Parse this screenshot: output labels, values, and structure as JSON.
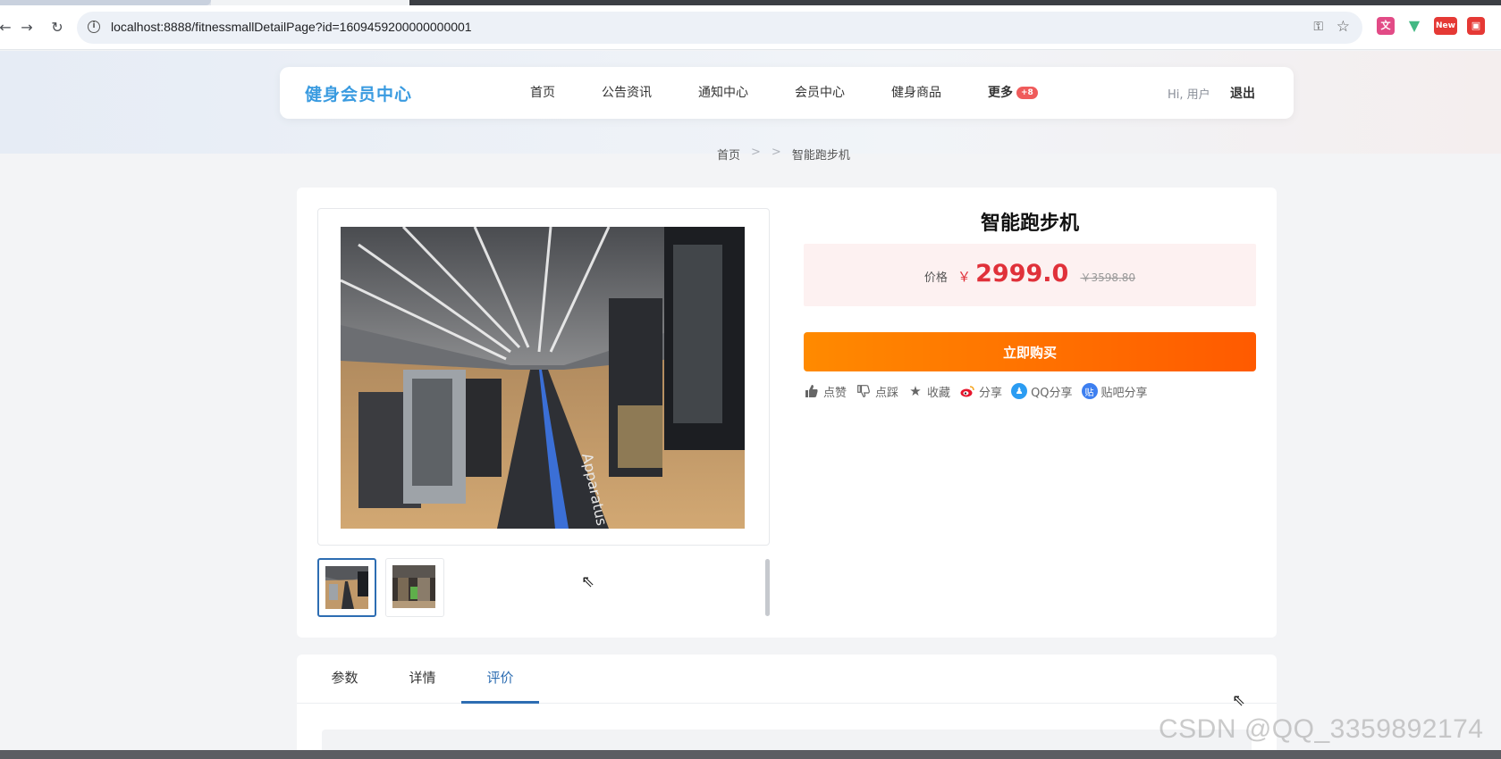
{
  "browser": {
    "url": "localhost:8888/fitnessmallDetailPage?id=1609459200000000001",
    "extensions": [
      "translate-ext",
      "vue-devtools-ext",
      "new-ext",
      "red-ext"
    ],
    "new_badge": "New"
  },
  "site": {
    "logo": "健身会员中心",
    "nav": [
      "首页",
      "公告资讯",
      "通知中心",
      "会员中心",
      "健身商品",
      "更多"
    ],
    "more_badge": "+8",
    "greeting": "Hi, 用户",
    "logout": "退出"
  },
  "breadcrumb": {
    "home": "首页",
    "sep1": ">",
    "sep2": ">",
    "current": "智能跑步机"
  },
  "product": {
    "title": "智能跑步机",
    "price_label": "价格",
    "currency": "￥",
    "price": "2999.0",
    "old_price": "￥3598.80",
    "buy_label": "立即购买",
    "actions": [
      "点赞",
      "点踩",
      "收藏",
      "分享",
      "QQ分享",
      "贴吧分享"
    ],
    "thumbnail_count": 2
  },
  "tabs": [
    "参数",
    "详情",
    "评价"
  ],
  "active_tab": "评价",
  "watermark": "CSDN @QQ_3359892174",
  "colors": {
    "accent_blue": "#2d6db2",
    "logo_blue": "#3a9be0",
    "price_red": "#e0313a",
    "buy_orange": "#ff6a00"
  }
}
